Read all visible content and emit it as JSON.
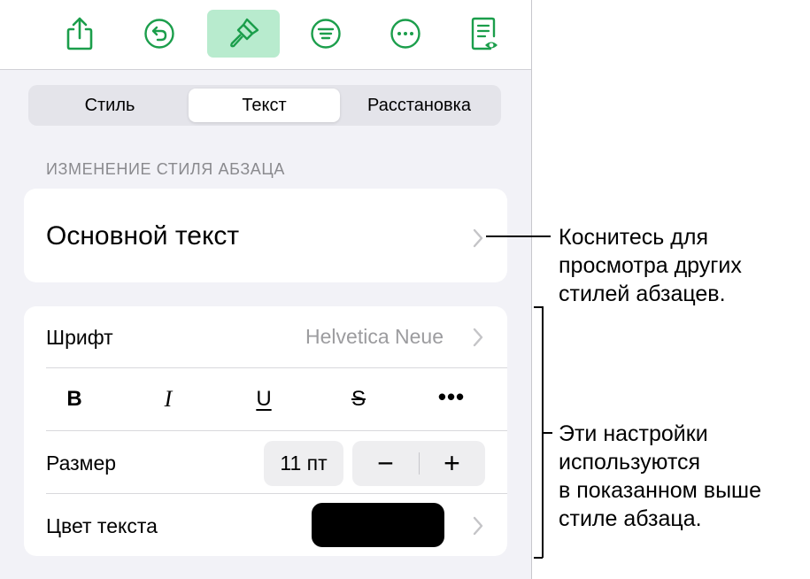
{
  "toolbar": {
    "icons": [
      "share-icon",
      "undo-icon",
      "format-brush-icon",
      "list-icon",
      "more-icon",
      "document-view-icon"
    ],
    "active": "format-brush-icon",
    "accent": "#1b9e4b",
    "active_bg": "#b8ebce"
  },
  "tabs": [
    {
      "label": "Стиль",
      "selected": false
    },
    {
      "label": "Текст",
      "selected": true
    },
    {
      "label": "Расстановка",
      "selected": false
    }
  ],
  "paragraph": {
    "section_title": "ИЗМЕНЕНИЕ СТИЛЯ АБЗАЦА",
    "style_name": "Основной текст"
  },
  "options": {
    "font_label": "Шрифт",
    "font_value": "Helvetica Neue",
    "format_buttons": {
      "bold": "B",
      "italic": "I",
      "underline": "U",
      "strikethrough": "S",
      "more": "•••"
    },
    "size_label": "Размер",
    "size_value": "11 пт",
    "decrease": "−",
    "increase": "+",
    "color_label": "Цвет текста",
    "color_value": "#000000"
  },
  "callouts": {
    "top": [
      "Коснитесь для",
      "просмотра других",
      "стилей абзацев."
    ],
    "bottom": [
      "Эти настройки",
      "используются",
      "в показанном выше",
      "стиле абзаца."
    ]
  }
}
